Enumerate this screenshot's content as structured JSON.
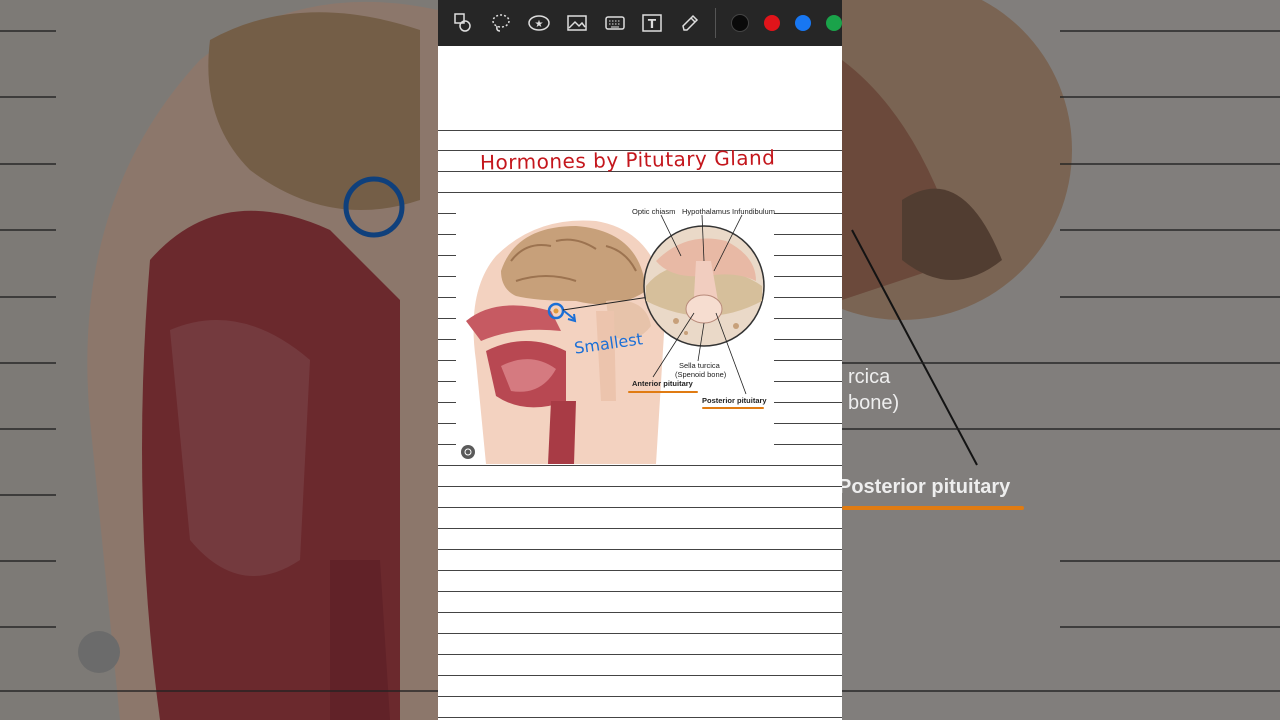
{
  "toolbar": {
    "tools": [
      "shapes-icon",
      "lasso-icon",
      "sticker-icon",
      "image-icon",
      "keyboard-icon",
      "text-box-icon",
      "highlighter-icon"
    ],
    "colors": [
      {
        "name": "black",
        "hex": "#0a0a0a"
      },
      {
        "name": "red",
        "hex": "#e1141a"
      },
      {
        "name": "blue",
        "hex": "#1877f2"
      },
      {
        "name": "green",
        "hex": "#1aa34a"
      }
    ]
  },
  "note": {
    "title": "Hormones by Pitutary Gland",
    "annotation": "Smallest"
  },
  "figure": {
    "labels": {
      "optic_chiasm": "Optic chiasm",
      "hypothalamus": "Hypothalamus",
      "infundibulum": "Infundibulum",
      "sella_turcica": "Sella turcica",
      "spenoid_bone": "(Spenoid bone)",
      "anterior_pituitary": "Anterior pituitary",
      "posterior_pituitary": "Posterior pituitary"
    }
  },
  "background_right": {
    "text1": "rcica",
    "text2": "bone)",
    "text3": "Posterior pituitary"
  }
}
